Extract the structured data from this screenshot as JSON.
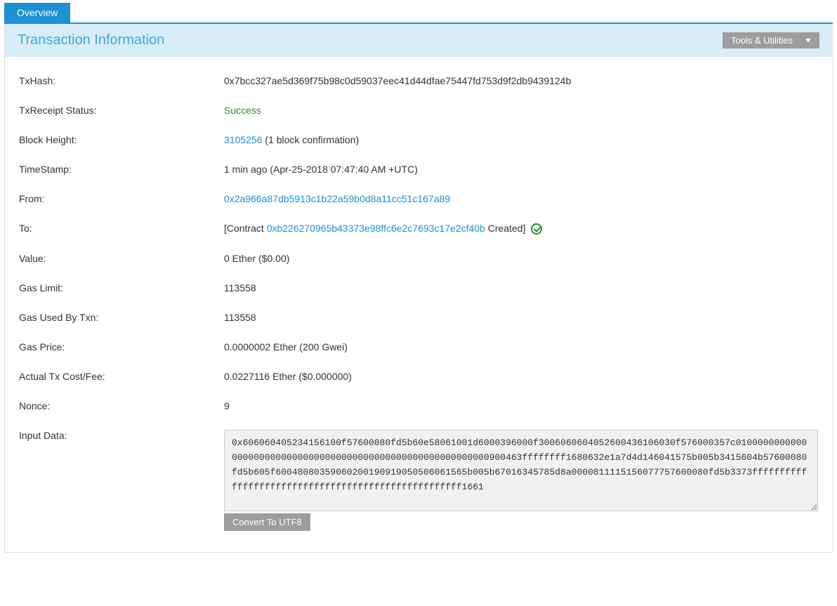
{
  "tabs": {
    "overview": "Overview"
  },
  "panel": {
    "title": "Transaction Information"
  },
  "tools": {
    "label": "Tools & Utilities"
  },
  "labels": {
    "txhash": "TxHash:",
    "status": "TxReceipt Status:",
    "block": "Block Height:",
    "timestamp": "TimeStamp:",
    "from": "From:",
    "to": "To:",
    "value": "Value:",
    "gaslimit": "Gas Limit:",
    "gasused": "Gas Used By Txn:",
    "gasprice": "Gas Price:",
    "cost": "Actual Tx Cost/Fee:",
    "nonce": "Nonce:",
    "input": "Input Data:"
  },
  "values": {
    "txhash": "0x7bcc327ae5d369f75b98c0d59037eec41d44dfae75447fd753d9f2db9439124b",
    "status": "Success",
    "block_link": "3105256",
    "block_suffix": " (1 block confirmation)",
    "timestamp": "1 min ago (Apr-25-2018 07:47:40 AM +UTC)",
    "from": "0x2a966a87db5913c1b22a59b0d8a11cc51c167a89",
    "to_prefix": "[Contract ",
    "to_addr": "0xb226270965b43373e98ffc6e2c7693c17e2cf40b",
    "to_suffix": " Created] ",
    "value": "0 Ether ($0.00)",
    "gaslimit": "113558",
    "gasused": "113558",
    "gasprice": "0.0000002 Ether (200 Gwei)",
    "cost": "0.0227116 Ether ($0.000000)",
    "nonce": "9",
    "input": "0x606060405234156100f57600080fd5b60e58061001d6000396000f3006060604052600436106030f576000357c010000000000000000000000000000000000000000000000000000000000900463ffffffff1680632e1a7d4d146041575b005b3415604b57600080fd5b605f60048080359060200190919050506061565b005b67016345785d8a0000811115156077757600080fd5b3373ffffffffffffffffffffffffffffffffffffffffffffffffffff1661"
  },
  "buttons": {
    "utf8": "Convert To UTF8"
  }
}
